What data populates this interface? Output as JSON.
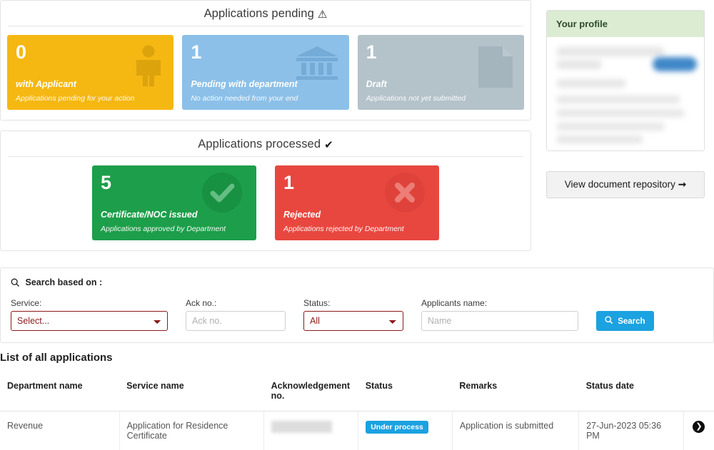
{
  "pending_panel": {
    "title": "Applications pending",
    "title_icon": "warning-triangle-icon",
    "cards": [
      {
        "count": "0",
        "label": "with Applicant",
        "sub": "Applications pending for your action",
        "color": "#f5b712",
        "icon": "person-icon"
      },
      {
        "count": "1",
        "label": "Pending with department",
        "sub": "No action needed from your end",
        "color": "#8cc0e8",
        "icon": "institution-bank-icon"
      },
      {
        "count": "1",
        "label": "Draft",
        "sub": "Applications not yet submitted",
        "color": "#b4c2ca",
        "icon": "document-page-icon"
      }
    ]
  },
  "processed_panel": {
    "title": "Applications processed",
    "title_icon": "check-mark-icon",
    "cards": [
      {
        "count": "5",
        "label": "Certificate/NOC issued",
        "sub": "Applications approved by Department",
        "color": "#1d9e4a",
        "icon": "check-circle-icon"
      },
      {
        "count": "1",
        "label": "Rejected",
        "sub": "Applications rejected by Department",
        "color": "#e8473f",
        "icon": "x-circle-icon"
      }
    ]
  },
  "profile": {
    "header": "Your profile",
    "header_bg": "#dbecd2",
    "content_redacted": true
  },
  "document_repository_button": {
    "label": "View document repository",
    "icon": "arrow-right-icon"
  },
  "search": {
    "heading": "Search based on :",
    "heading_icon": "search-icon",
    "fields": {
      "service": {
        "label": "Service:",
        "value": "Select...",
        "options": [
          "Select..."
        ]
      },
      "ack_no": {
        "label": "Ack no.:",
        "value": "",
        "placeholder": "Ack no."
      },
      "status": {
        "label": "Status:",
        "value": "All",
        "options": [
          "All"
        ]
      },
      "applicants_name": {
        "label": "Applicants name:",
        "value": "",
        "placeholder": "Name"
      }
    },
    "button": {
      "label": "Search",
      "icon": "search-icon",
      "color": "#1ba2e0"
    }
  },
  "list": {
    "title": "List of all applications",
    "columns": [
      "Department name",
      "Service name",
      "Acknowledgement no.",
      "Status",
      "Remarks",
      "Status date",
      ""
    ],
    "rows": [
      {
        "department": "Revenue",
        "service": "Application for Residence Certificate",
        "ack_no": "",
        "ack_redacted": true,
        "status": "Under process",
        "status_color": "#1ba2e0",
        "remarks": "Application is submitted",
        "status_date": "27-Jun-2023 05:36 PM",
        "action_icon": "chevron-right-circle-icon"
      }
    ]
  }
}
